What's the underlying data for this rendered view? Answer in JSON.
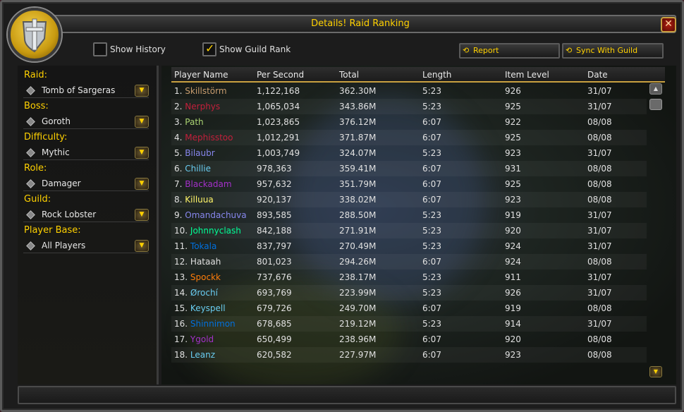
{
  "window": {
    "title": "Details! Raid Ranking",
    "close_symbol": "✕",
    "emblem_icon": "sword-shield-icon"
  },
  "toolbar": {
    "show_history_label": "Show History",
    "show_history_checked": false,
    "show_guild_rank_label": "Show Guild Rank",
    "show_guild_rank_checked": true,
    "report_label": "Report",
    "sync_label": "Sync With Guild"
  },
  "filters": [
    {
      "label": "Raid:",
      "value": "Tomb of Sargeras"
    },
    {
      "label": "Boss:",
      "value": "Goroth"
    },
    {
      "label": "Difficulty:",
      "value": "Mythic"
    },
    {
      "label": "Role:",
      "value": "Damager"
    },
    {
      "label": "Guild:",
      "value": "Rock Lobster"
    },
    {
      "label": "Player Base:",
      "value": "All Players"
    }
  ],
  "table": {
    "headers": [
      "Player Name",
      "Per Second",
      "Total",
      "Length",
      "Item Level",
      "Date"
    ],
    "rows": [
      {
        "rank": "1.",
        "name": "Skillstörm",
        "color": "#c79c6e",
        "dps": "1,122,168",
        "total": "362.30M",
        "length": "5:23",
        "ilvl": "926",
        "date": "31/07"
      },
      {
        "rank": "2.",
        "name": "Nerphys",
        "color": "#c41f3b",
        "dps": "1,065,034",
        "total": "343.86M",
        "length": "5:23",
        "ilvl": "925",
        "date": "31/07"
      },
      {
        "rank": "3.",
        "name": "Path",
        "color": "#abd473",
        "dps": "1,023,865",
        "total": "376.12M",
        "length": "6:07",
        "ilvl": "922",
        "date": "08/08"
      },
      {
        "rank": "4.",
        "name": "Mephisstoo",
        "color": "#c41f3b",
        "dps": "1,012,291",
        "total": "371.87M",
        "length": "6:07",
        "ilvl": "925",
        "date": "08/08"
      },
      {
        "rank": "5.",
        "name": "Bilaubr",
        "color": "#8787ed",
        "dps": "1,003,749",
        "total": "324.07M",
        "length": "5:23",
        "ilvl": "923",
        "date": "31/07"
      },
      {
        "rank": "6.",
        "name": "Chillie",
        "color": "#69ccf0",
        "dps": "978,363",
        "total": "359.41M",
        "length": "6:07",
        "ilvl": "931",
        "date": "08/08"
      },
      {
        "rank": "7.",
        "name": "Blackadam",
        "color": "#a330c9",
        "dps": "957,632",
        "total": "351.79M",
        "length": "6:07",
        "ilvl": "925",
        "date": "08/08"
      },
      {
        "rank": "8.",
        "name": "Killuua",
        "color": "#fff569",
        "dps": "920,137",
        "total": "338.02M",
        "length": "6:07",
        "ilvl": "923",
        "date": "08/08"
      },
      {
        "rank": "9.",
        "name": "Omandachuva",
        "color": "#8787ed",
        "dps": "893,585",
        "total": "288.50M",
        "length": "5:23",
        "ilvl": "919",
        "date": "31/07"
      },
      {
        "rank": "10.",
        "name": "Johnnyclash",
        "color": "#00ff96",
        "dps": "842,188",
        "total": "271.91M",
        "length": "5:23",
        "ilvl": "920",
        "date": "31/07"
      },
      {
        "rank": "11.",
        "name": "Tokala",
        "color": "#0070de",
        "dps": "837,797",
        "total": "270.49M",
        "length": "5:23",
        "ilvl": "924",
        "date": "31/07"
      },
      {
        "rank": "12.",
        "name": "Hataah",
        "color": "#e0e0e0",
        "dps": "801,023",
        "total": "294.26M",
        "length": "6:07",
        "ilvl": "924",
        "date": "08/08"
      },
      {
        "rank": "13.",
        "name": "Spockk",
        "color": "#ff7d0a",
        "dps": "737,676",
        "total": "238.17M",
        "length": "5:23",
        "ilvl": "911",
        "date": "31/07"
      },
      {
        "rank": "14.",
        "name": "Ørochí",
        "color": "#69ccf0",
        "dps": "693,769",
        "total": "223.99M",
        "length": "5:23",
        "ilvl": "926",
        "date": "31/07"
      },
      {
        "rank": "15.",
        "name": "Keyspell",
        "color": "#69ccf0",
        "dps": "679,726",
        "total": "249.70M",
        "length": "6:07",
        "ilvl": "919",
        "date": "08/08"
      },
      {
        "rank": "16.",
        "name": "Shinnimon",
        "color": "#0070de",
        "dps": "678,685",
        "total": "219.12M",
        "length": "5:23",
        "ilvl": "914",
        "date": "31/07"
      },
      {
        "rank": "17.",
        "name": "Ygold",
        "color": "#a330c9",
        "dps": "650,499",
        "total": "238.96M",
        "length": "6:07",
        "ilvl": "920",
        "date": "08/08"
      },
      {
        "rank": "18.",
        "name": "Leanz",
        "color": "#69ccf0",
        "dps": "620,582",
        "total": "227.97M",
        "length": "6:07",
        "ilvl": "923",
        "date": "08/08"
      }
    ]
  },
  "icons": {
    "filter_bullet": "diamond-bullet-icon",
    "dropdown": "dropdown-arrow-icon",
    "report": "report-icon",
    "sync": "sync-icon",
    "scroll_up": "scroll-up-icon",
    "scroll_down": "scroll-down-icon"
  }
}
